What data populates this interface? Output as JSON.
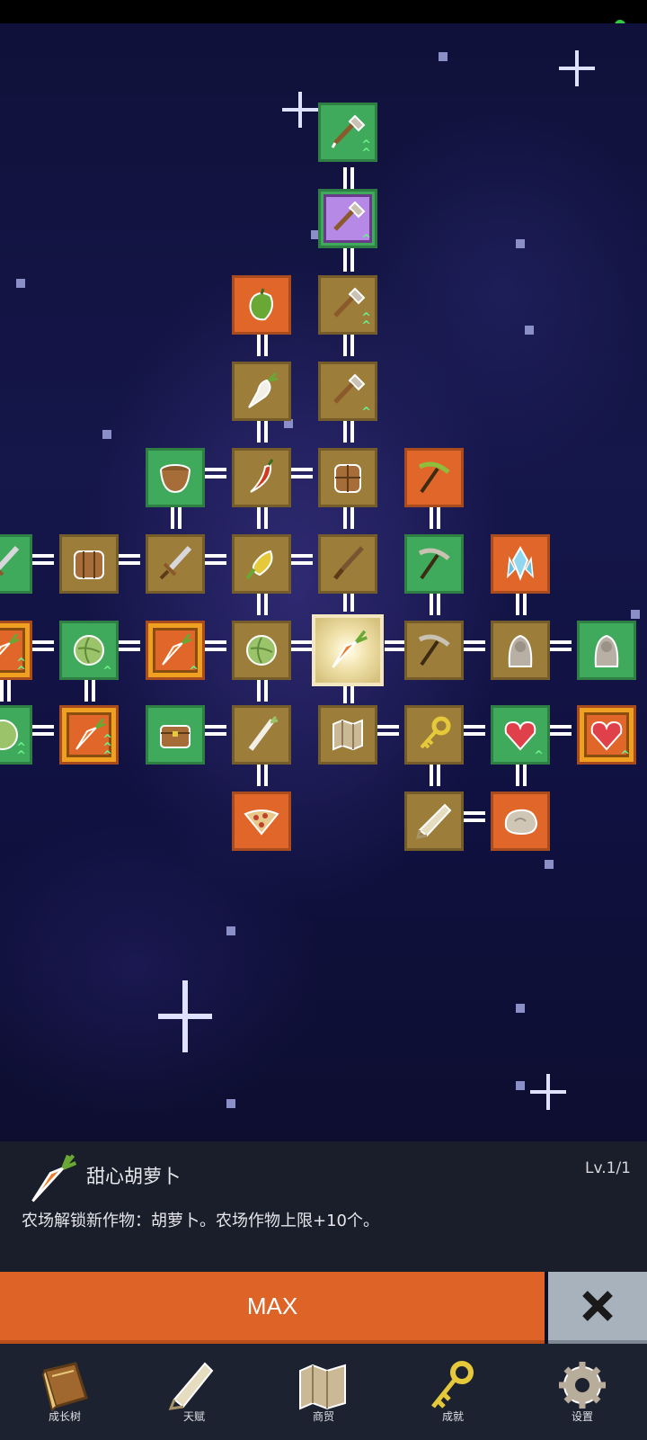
{
  "colors": {
    "node_brown": "#9c7d3a",
    "node_green": "#3faa5c",
    "node_orange": "#e0662a",
    "max_button": "#dd6426",
    "close_button": "#a7b2bd",
    "panel_bg": "#1a1e2a",
    "nav_bg": "#1c2230"
  },
  "skill_panel": {
    "icon": "carrot-icon",
    "name": "甜心胡萝卜",
    "level": "Lv.1/1",
    "description": "农场解锁新作物：胡萝卜。农场作物上限+10个。"
  },
  "actions": {
    "max_label": "MAX",
    "close_icon": "close-x-icon"
  },
  "bottom_nav": [
    {
      "label": "成长树",
      "icon": "book-icon"
    },
    {
      "label": "天赋",
      "icon": "scroll-icon"
    },
    {
      "label": "商贸",
      "icon": "map-icon"
    },
    {
      "label": "成就",
      "icon": "key-icon"
    },
    {
      "label": "设置",
      "icon": "gear-icon"
    }
  ],
  "skill_tree_nodes": [
    {
      "icon": "shovel-icon",
      "color": "green",
      "upgrades": 2
    },
    {
      "icon": "shovel-icon",
      "color": "purple",
      "upgrades": 1
    },
    {
      "icon": "pepper-icon",
      "color": "orange",
      "upgrades": 0
    },
    {
      "icon": "shovel-icon",
      "color": "brown",
      "upgrades": 2
    },
    {
      "icon": "radish-icon",
      "color": "brown",
      "upgrades": 0
    },
    {
      "icon": "shovel-icon",
      "color": "brown",
      "upgrades": 1
    },
    {
      "icon": "pot-icon",
      "color": "green",
      "upgrades": 0
    },
    {
      "icon": "chili-icon",
      "color": "brown",
      "upgrades": 0
    },
    {
      "icon": "backpack-icon",
      "color": "brown",
      "upgrades": 0
    },
    {
      "icon": "pickaxe-icon",
      "color": "orange",
      "upgrades": 0
    },
    {
      "icon": "sword-icon",
      "color": "green",
      "upgrades": 0
    },
    {
      "icon": "backpack-icon",
      "color": "brown",
      "upgrades": 0
    },
    {
      "icon": "sword-icon",
      "color": "brown",
      "upgrades": 0
    },
    {
      "icon": "corn-icon",
      "color": "brown",
      "upgrades": 0
    },
    {
      "icon": "sword-icon",
      "color": "brown",
      "upgrades": 0
    },
    {
      "icon": "pickaxe-icon",
      "color": "green",
      "upgrades": 0
    },
    {
      "icon": "crystal-icon",
      "color": "orange",
      "upgrades": 0
    },
    {
      "icon": "carrot-icon",
      "color": "orange",
      "upgrades": 2
    },
    {
      "icon": "cabbage-icon",
      "color": "green",
      "upgrades": 1
    },
    {
      "icon": "carrot-icon",
      "color": "orange",
      "upgrades": 1
    },
    {
      "icon": "cabbage-icon",
      "color": "brown",
      "upgrades": 0
    },
    {
      "icon": "carrot-icon",
      "color": "selected",
      "upgrades": 0
    },
    {
      "icon": "pickaxe-icon",
      "color": "brown",
      "upgrades": 0
    },
    {
      "icon": "statue-icon",
      "color": "brown",
      "upgrades": 0
    },
    {
      "icon": "statue-icon",
      "color": "green",
      "upgrades": 0
    },
    {
      "icon": "cabbage-icon",
      "color": "green",
      "upgrades": 2
    },
    {
      "icon": "carrot-icon",
      "color": "orange",
      "upgrades": 3
    },
    {
      "icon": "chest-icon",
      "color": "green",
      "upgrades": 0
    },
    {
      "icon": "leek-icon",
      "color": "brown",
      "upgrades": 0
    },
    {
      "icon": "map-icon",
      "color": "brown",
      "upgrades": 0
    },
    {
      "icon": "key-icon",
      "color": "brown",
      "upgrades": 0
    },
    {
      "icon": "heart-icon",
      "color": "green",
      "upgrades": 1
    },
    {
      "icon": "heart-icon",
      "color": "orange",
      "upgrades": 1
    },
    {
      "icon": "pizza-icon",
      "color": "orange",
      "upgrades": 0
    },
    {
      "icon": "scroll-icon",
      "color": "brown",
      "upgrades": 0
    },
    {
      "icon": "stone-icon",
      "color": "orange",
      "upgrades": 0
    }
  ]
}
